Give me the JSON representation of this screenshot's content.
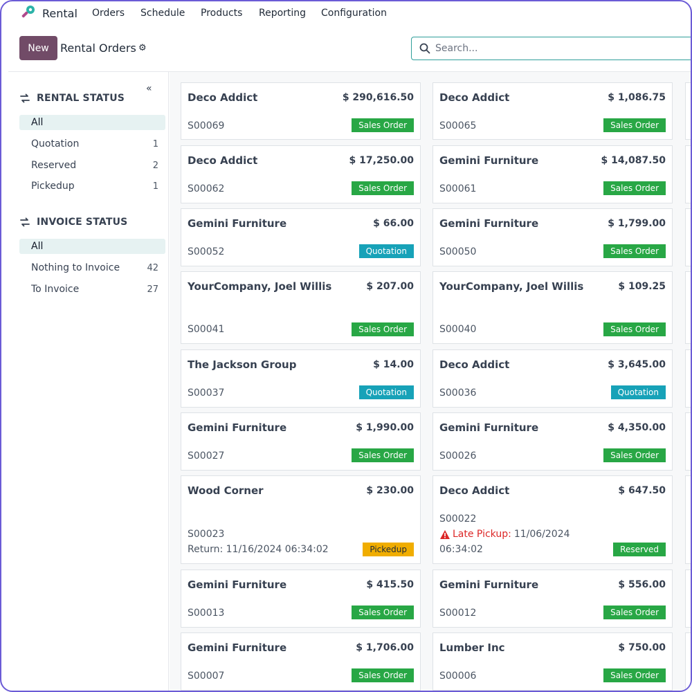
{
  "nav": {
    "app_name": "Rental",
    "menu": [
      "Orders",
      "Schedule",
      "Products",
      "Reporting",
      "Configuration"
    ]
  },
  "control": {
    "new_label": "New",
    "title": "Rental Orders",
    "search_placeholder": "Search..."
  },
  "sidebar": {
    "rental_status": {
      "label": "RENTAL STATUS",
      "items": [
        {
          "label": "All",
          "count": ""
        },
        {
          "label": "Quotation",
          "count": "1"
        },
        {
          "label": "Reserved",
          "count": "2"
        },
        {
          "label": "Pickedup",
          "count": "1"
        }
      ]
    },
    "invoice_status": {
      "label": "INVOICE STATUS",
      "items": [
        {
          "label": "All",
          "count": ""
        },
        {
          "label": "Nothing to Invoice",
          "count": "42"
        },
        {
          "label": "To Invoice",
          "count": "27"
        }
      ]
    }
  },
  "cards": [
    {
      "partner": "Deco Addict",
      "amount": "$ 290,616.50",
      "ref": "S00069",
      "status": "Sales Order"
    },
    {
      "partner": "Deco Addict",
      "amount": "$ 1,086.75",
      "ref": "S00065",
      "status": "Sales Order"
    },
    {
      "partner": "Deco Addict",
      "amount": "$ 17,250.00",
      "ref": "S00062",
      "status": "Sales Order"
    },
    {
      "partner": "Gemini Furniture",
      "amount": "$ 14,087.50",
      "ref": "S00061",
      "status": "Sales Order"
    },
    {
      "partner": "Gemini Furniture",
      "amount": "$ 66.00",
      "ref": "S00052",
      "status": "Quotation"
    },
    {
      "partner": "Gemini Furniture",
      "amount": "$ 1,799.00",
      "ref": "S00050",
      "status": "Sales Order"
    },
    {
      "partner": "YourCompany, Joel Willis",
      "amount": "$ 207.00",
      "ref": "S00041",
      "status": "Sales Order"
    },
    {
      "partner": "YourCompany, Joel Willis",
      "amount": "$ 109.25",
      "ref": "S00040",
      "status": "Sales Order"
    },
    {
      "partner": "The Jackson Group",
      "amount": "$ 14.00",
      "ref": "S00037",
      "status": "Quotation"
    },
    {
      "partner": "Deco Addict",
      "amount": "$ 3,645.00",
      "ref": "S00036",
      "status": "Quotation"
    },
    {
      "partner": "Gemini Furniture",
      "amount": "$ 1,990.00",
      "ref": "S00027",
      "status": "Sales Order"
    },
    {
      "partner": "Gemini Furniture",
      "amount": "$ 4,350.00",
      "ref": "S00026",
      "status": "Sales Order"
    },
    {
      "partner": "Wood Corner",
      "amount": "$ 230.00",
      "ref": "S00023",
      "return": "Return: 11/16/2024 06:34:02",
      "status": "Pickedup"
    },
    {
      "partner": "Deco Addict",
      "amount": "$ 647.50",
      "ref": "S00022",
      "late_label": "Late Pickup:",
      "late_date": "11/06/2024",
      "late_time": "06:34:02",
      "status": "Reserved"
    },
    {
      "partner": "Gemini Furniture",
      "amount": "$ 415.50",
      "ref": "S00013",
      "status": "Sales Order"
    },
    {
      "partner": "Gemini Furniture",
      "amount": "$ 556.00",
      "ref": "S00012",
      "status": "Sales Order"
    },
    {
      "partner": "Gemini Furniture",
      "amount": "$ 1,706.00",
      "ref": "S00007",
      "status": "Sales Order"
    },
    {
      "partner": "Lumber Inc",
      "amount": "$ 750.00",
      "ref": "S00006",
      "status": "Sales Order"
    }
  ],
  "colors": {
    "primary": "#714b67",
    "sales_order": "#28a745",
    "quotation": "#17a2b8",
    "pickedup": "#f0ad00",
    "late": "#dc2626",
    "active_filter": "#e6f2f2"
  }
}
